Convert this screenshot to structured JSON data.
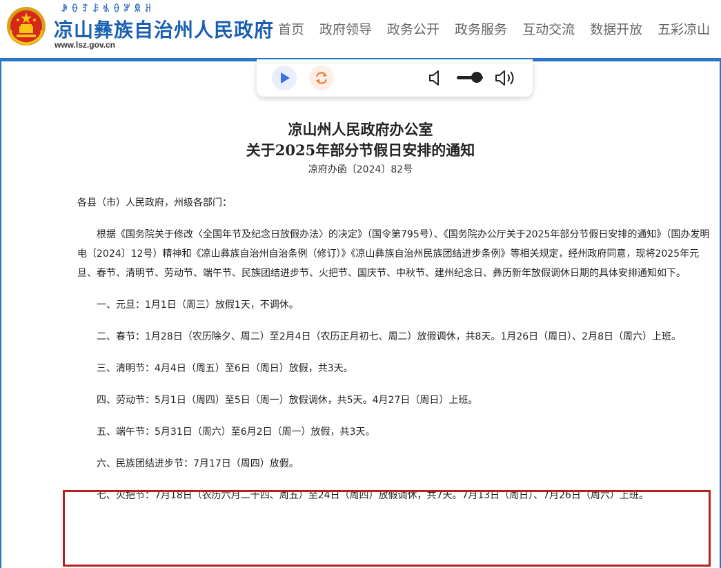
{
  "header": {
    "yi_script": "ꆃꂷꆈꌠꁱꂷꏃꌋꃅ",
    "site_title": "凉山彝族自治州人民政府",
    "site_url": "www.lsz.gov.cn",
    "nav": [
      "首页",
      "政府领导",
      "政务公开",
      "政务服务",
      "互动交流",
      "数据开放",
      "五彩凉山"
    ]
  },
  "player": {
    "play_icon": "play-icon",
    "reload_icon": "reload-icon",
    "volume_low_icon": "volume-low-icon",
    "volume_high_icon": "volume-high-icon",
    "volume_level": 0.75
  },
  "document": {
    "title_line1": "凉山州人民政府办公室",
    "title_line2": "关于2025年部分节假日安排的通知",
    "doc_number": "凉府办函〔2024〕82号",
    "salutation": "各县（市）人民政府，州级各部门：",
    "paragraphs": [
      "根据《国务院关于修改〈全国年节及纪念日放假办法〉的决定》（国令第795号）、《国务院办公厅关于2025年部分节假日安排的通知》（国办发明电〔2024〕12号）精神和《凉山彝族自治州自治条例（修订）》《凉山彝族自治州民族团结进步条例》等相关规定，经州政府同意，现将2025年元旦、春节、清明节、劳动节、端午节、民族团结进步节、火把节、国庆节、中秋节、建州纪念日、彝历新年放假调休日期的具体安排通知如下。",
      "一、元旦：1月1日（周三）放假1天，不调休。",
      "二、春节：1月28日（农历除夕、周二）至2月4日（农历正月初七、周二）放假调休，共8天。1月26日（周日）、2月8日（周六）上班。",
      "三、清明节：4月4日（周五）至6日（周日）放假，共3天。",
      "四、劳动节：5月1日（周四）至5日（周一）放假调休，共5天。4月27日（周日）上班。",
      "五、端午节：5月31日（周六）至6月2日（周一）放假，共3天。",
      "六、民族团结进步节：7月17日（周四）放假。",
      "七、火把节：7月18日（农历六月二十四、周五）至24日（周四）放假调休，共7天。7月13日（周日）、7月26日（周六）上班。"
    ]
  },
  "colors": {
    "brand_blue": "#1b5fb3",
    "header_bar": "#2a77c9",
    "highlight_red": "#b5201b"
  }
}
